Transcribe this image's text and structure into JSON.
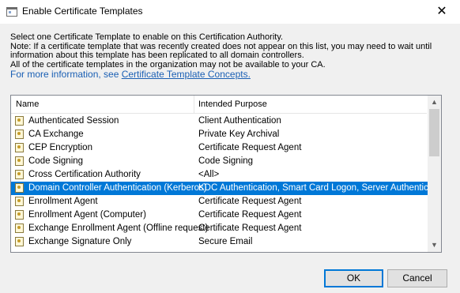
{
  "window": {
    "title": "Enable Certificate Templates",
    "close_glyph": "✕"
  },
  "description": {
    "lines": [
      "Select one Certificate Template to enable on this Certification Authority.",
      "Note: If a certificate template that was recently created does not appear on this list, you may need to wait until",
      "information about this template has been replicated to all domain controllers.",
      "All of the certificate templates in the organization may not be available to your CA."
    ],
    "more_info_prefix": "For more information, see ",
    "more_info_link": "Certificate Template Concepts."
  },
  "list": {
    "columns": {
      "name": "Name",
      "purpose": "Intended Purpose"
    },
    "rows": [
      {
        "name": "Authenticated Session",
        "purpose": "Client Authentication",
        "selected": false
      },
      {
        "name": "CA Exchange",
        "purpose": "Private Key Archival",
        "selected": false
      },
      {
        "name": "CEP Encryption",
        "purpose": "Certificate Request Agent",
        "selected": false
      },
      {
        "name": "Code Signing",
        "purpose": "Code Signing",
        "selected": false
      },
      {
        "name": "Cross Certification Authority",
        "purpose": "<All>",
        "selected": false
      },
      {
        "name": "Domain Controller Authentication (Kerberos)",
        "purpose": "KDC Authentication, Smart Card Logon, Server Authentication",
        "selected": true
      },
      {
        "name": "Enrollment Agent",
        "purpose": "Certificate Request Agent",
        "selected": false
      },
      {
        "name": "Enrollment Agent (Computer)",
        "purpose": "Certificate Request Agent",
        "selected": false
      },
      {
        "name": "Exchange Enrollment Agent (Offline request)",
        "purpose": "Certificate Request Agent",
        "selected": false
      },
      {
        "name": "Exchange Signature Only",
        "purpose": "Secure Email",
        "selected": false
      }
    ],
    "icon": "certificate-template-icon",
    "scroll": {
      "up_glyph": "▲",
      "down_glyph": "▼"
    }
  },
  "buttons": {
    "ok": "OK",
    "cancel": "Cancel"
  },
  "colors": {
    "selection": "#0078d7",
    "link": "#1a5fb4",
    "default_button_border": "#0078d7"
  }
}
